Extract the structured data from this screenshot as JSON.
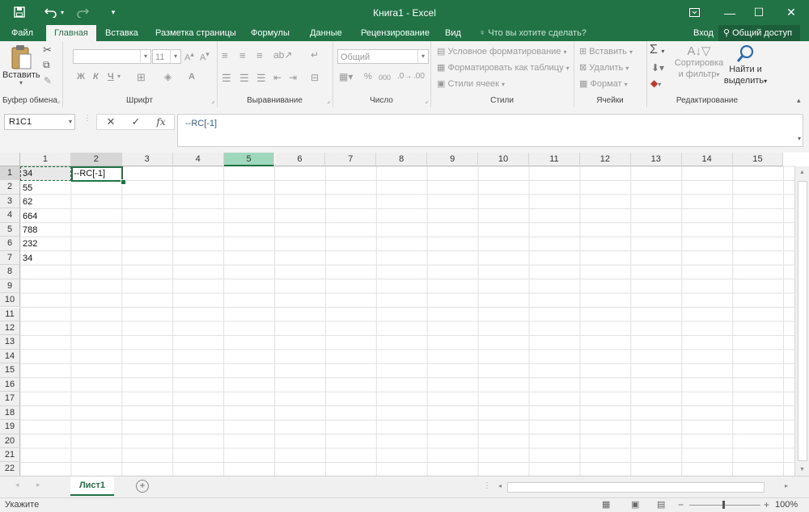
{
  "titlebar": {
    "title": "Книга1 - Excel",
    "save_icon": "save-icon",
    "undo_icon": "undo-icon",
    "redo_icon": "redo-icon",
    "customize_icon": "chevron-down-icon",
    "ribbon_display_icon": "ribbon-display-options-icon",
    "minimize_glyph": "—",
    "maximize_glyph": "☐",
    "close_glyph": "✕"
  },
  "tabs": [
    {
      "label": "Файл"
    },
    {
      "label": "Главная"
    },
    {
      "label": "Вставка"
    },
    {
      "label": "Разметка страницы"
    },
    {
      "label": "Формулы"
    },
    {
      "label": "Данные"
    },
    {
      "label": "Рецензирование"
    },
    {
      "label": "Вид"
    }
  ],
  "tellme": "Что вы хотите сделать?",
  "login": "Вход",
  "share": "Общий доступ",
  "ribbon": {
    "clipboard": {
      "paste": "Вставить",
      "label": "Буфер обмена"
    },
    "font": {
      "name_value": "",
      "size_value": "11",
      "bold": "Ж",
      "italic": "К",
      "underline": "Ч",
      "label": "Шрифт"
    },
    "alignment": {
      "label": "Выравнивание"
    },
    "number": {
      "format": "Общий",
      "percent": "%",
      "thousands": "000",
      "label": "Число"
    },
    "styles": {
      "conditional": "Условное форматирование",
      "table": "Форматировать как таблицу",
      "cell": "Стили ячеек",
      "label": "Стили"
    },
    "cells": {
      "insert": "Вставить",
      "delete": "Удалить",
      "format": "Формат",
      "label": "Ячейки"
    },
    "editing": {
      "sum": "Σ",
      "sort_line1": "Сортировка",
      "sort_line2": "и фильтр",
      "find_line1": "Найти и",
      "find_line2": "выделить",
      "label": "Редактирование"
    }
  },
  "formula_bar": {
    "name_box": "R1C1",
    "cancel": "✕",
    "enter": "✓",
    "fx": "fx",
    "content": "--RC[-1]"
  },
  "grid": {
    "columns": [
      "1",
      "2",
      "3",
      "4",
      "5",
      "6",
      "7",
      "8",
      "9",
      "10",
      "11",
      "12",
      "13",
      "14",
      "15"
    ],
    "rows": [
      "1",
      "2",
      "3",
      "4",
      "5",
      "6",
      "7",
      "8",
      "9",
      "10",
      "11",
      "12",
      "13",
      "14",
      "15",
      "16",
      "17",
      "18",
      "19",
      "20",
      "21",
      "22"
    ],
    "col1_values": [
      "34",
      "55",
      "62",
      "664",
      "788",
      "232",
      "34"
    ],
    "editing_cell_value": "--RC[-1]"
  },
  "sheets": {
    "active": "Лист1",
    "add": "+"
  },
  "status": {
    "mode": "Укажите",
    "zoom": "100%"
  }
}
